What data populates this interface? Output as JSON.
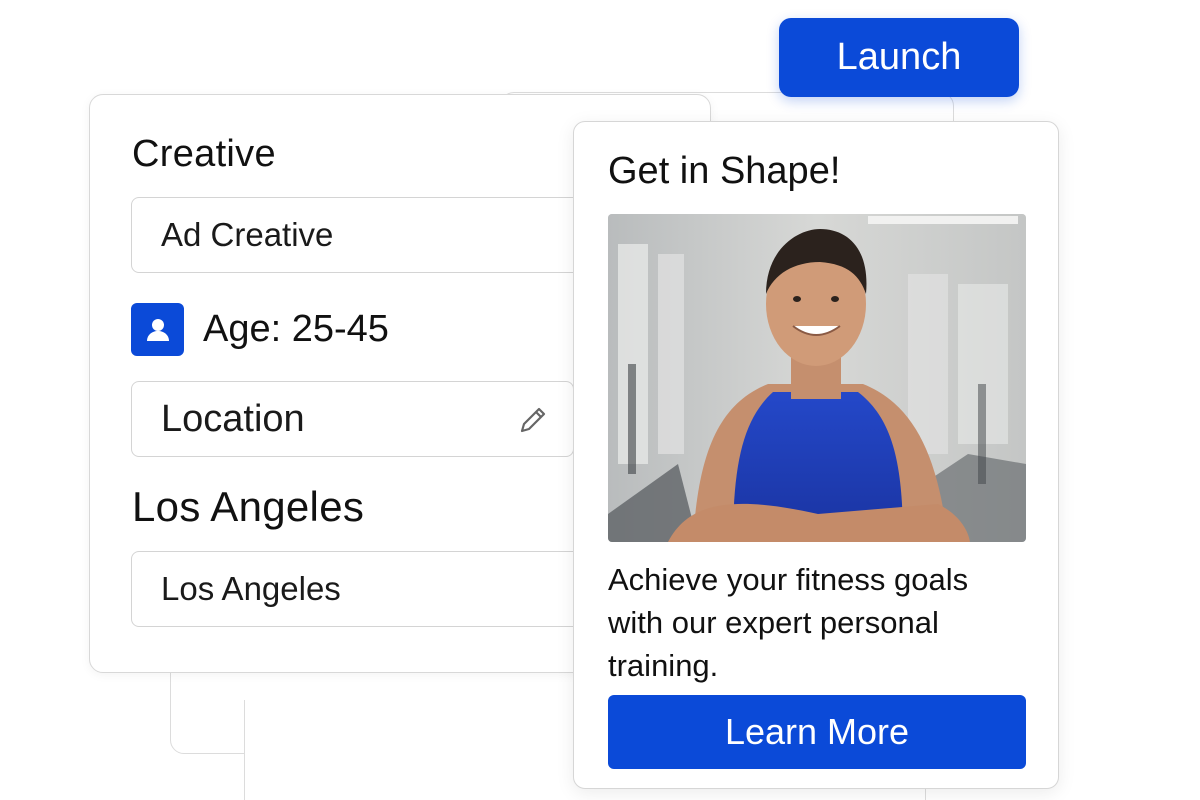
{
  "header": {
    "launch_label": "Launch"
  },
  "form": {
    "creative_title": "Creative",
    "creative_field_value": "Ad Creative",
    "age_label": "Age: 25-45",
    "location_field_value": "Location",
    "city_title": "Los Angeles",
    "city_field_value": "Los Angeles"
  },
  "ad_preview": {
    "headline": "Get in Shape!",
    "image_description_icon": "fitness-trainer-photo",
    "body_text": "Achieve your fitness goals with our expert personal training.",
    "cta_label": "Learn More"
  },
  "colors": {
    "accent": "#0b4ad8",
    "card_border": "#d8d8d8",
    "background": "#ffffff"
  },
  "icons": {
    "user_badge": "user-icon",
    "location_edit": "pencil-icon"
  }
}
